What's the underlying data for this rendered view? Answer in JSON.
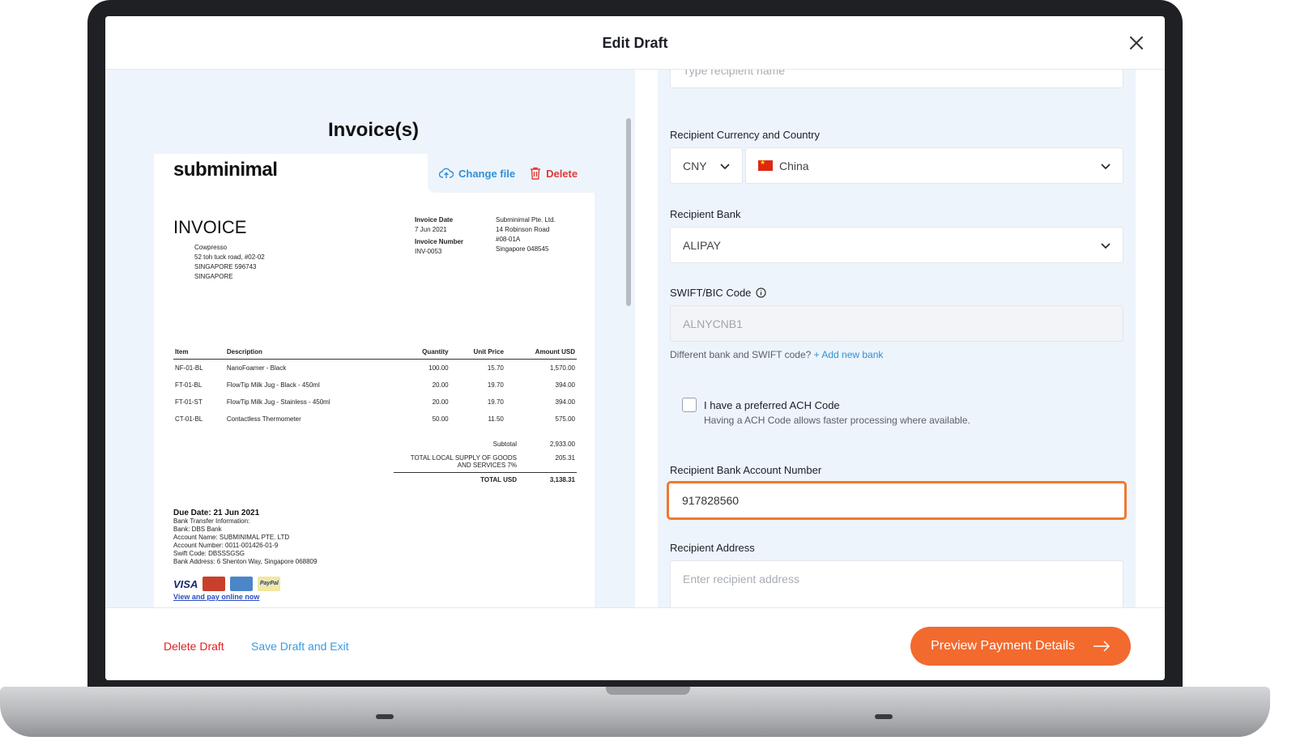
{
  "modal": {
    "title": "Edit Draft"
  },
  "invoice_panel": {
    "title": "Invoice(s)",
    "actions": {
      "change_file": "Change file",
      "delete": "Delete"
    },
    "doc": {
      "brand": "subminimal",
      "heading": "INVOICE",
      "to_lines": [
        "Cowpresso",
        "52 toh tuck road, #02-02",
        "SINGAPORE 596743",
        "SINGAPORE"
      ],
      "invoice_date_label": "Invoice Date",
      "invoice_date": "7 Jun 2021",
      "invoice_number_label": "Invoice Number",
      "invoice_number": "INV-0053",
      "from_lines": [
        "Subminimal Pte. Ltd.",
        "14 Robinson Road",
        "#08-01A",
        "Singapore 048545"
      ],
      "table_headers": [
        "Item",
        "Description",
        "Quantity",
        "Unit Price",
        "Amount USD"
      ],
      "rows": [
        [
          "NF-01-BL",
          "NanoFoamer - Black",
          "100.00",
          "15.70",
          "1,570.00"
        ],
        [
          "FT-01-BL",
          "FlowTip Milk Jug - Black - 450ml",
          "20.00",
          "19.70",
          "394.00"
        ],
        [
          "FT-01-ST",
          "FlowTip Milk Jug - Stainless - 450ml",
          "20.00",
          "19.70",
          "394.00"
        ],
        [
          "CT-01-BL",
          "Contactless Thermometer",
          "50.00",
          "11.50",
          "575.00"
        ]
      ],
      "subtotal_label": "Subtotal",
      "subtotal": "2,933.00",
      "tax_label_1": "TOTAL  LOCAL SUPPLY OF GOODS",
      "tax_label_2": "AND SERVICES 7%",
      "tax": "205.31",
      "total_label": "TOTAL USD",
      "total": "3,138.31",
      "due_date": "Due Date: 21 Jun 2021",
      "bank_lines": [
        "Bank Transfer Information:",
        "Bank: DBS Bank",
        "Account Name: SUBMINIMAL PTE. LTD",
        "Account Number: 0011-001426-01-9",
        "Swift Code: DBSSSGSG",
        "Bank Address: 6 Shenton Way, Singapore 068809"
      ],
      "visa": "VISA",
      "paypal": "PayPal",
      "view_link": "View and pay online now"
    }
  },
  "form": {
    "recipient_name_placeholder": "Type recipient name",
    "currency_country_label": "Recipient Currency and Country",
    "currency": "CNY",
    "country": "China",
    "bank_label": "Recipient Bank",
    "bank": "ALIPAY",
    "swift_label": "SWIFT/BIC Code",
    "swift_value": "ALNYCNB1",
    "helper_text": "Different bank and SWIFT code?",
    "add_bank": "+ Add new bank",
    "ach_title": "I have a preferred ACH Code",
    "ach_sub": "Having a ACH Code allows faster processing where available.",
    "account_label": "Recipient Bank Account Number",
    "account_value": "917828560",
    "address_label": "Recipient Address",
    "address_placeholder": "Enter recipient address"
  },
  "footer": {
    "delete_draft": "Delete  Draft",
    "save_exit": "Save Draft and Exit",
    "preview": "Preview Payment Details"
  },
  "colors": {
    "accent": "#f26a2e",
    "link": "#2f8fd8",
    "danger": "#e02020",
    "focus": "#f07830"
  }
}
